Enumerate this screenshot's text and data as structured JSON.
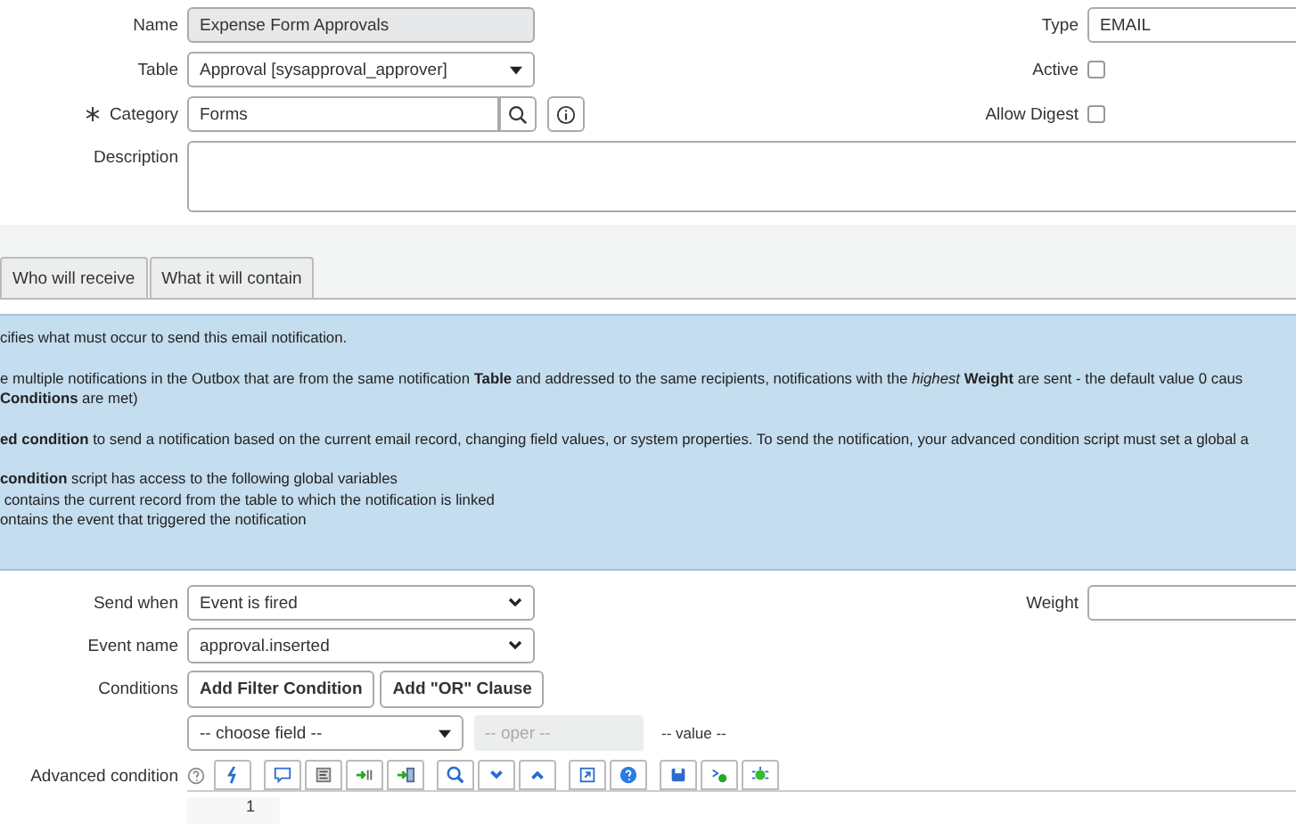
{
  "form": {
    "name": {
      "label": "Name",
      "value": "Expense Form Approvals",
      "readonly": true
    },
    "table": {
      "label": "Table",
      "value": "Approval [sysapproval_approver]"
    },
    "category": {
      "label": "Category",
      "value": "Forms",
      "required": true
    },
    "description": {
      "label": "Description"
    },
    "type": {
      "label": "Type",
      "value": "EMAIL"
    },
    "active": {
      "label": "Active",
      "checked": false
    },
    "allow_digest": {
      "label": "Allow Digest",
      "checked": false
    }
  },
  "tabs": [
    {
      "label": "Who will receive",
      "selected": false
    },
    {
      "label": "What it will contain",
      "selected": false
    }
  ],
  "info": [
    [
      "cifies what must occur to send this email notification."
    ],
    [
      "e multiple notifications in the Outbox that are from the same notification **Table** and addressed to the same recipients, notifications with the *highest* **Weight** are sent - the default value 0 caus",
      "**Conditions** are met)"
    ],
    [
      "**ed condition** to send a notification based on the current email record, changing field values, or system properties. To send the notification, your advanced condition script must set a global a"
    ],
    [
      "**condition** script has access to the following global variables",
      " contains the current record from the table to which the notification is linked",
      "ontains the event that triggered the notification"
    ]
  ],
  "send_when": {
    "label": "Send when",
    "value": "Event is fired"
  },
  "weight": {
    "label": "Weight"
  },
  "event_name": {
    "label": "Event name",
    "value": "approval.inserted"
  },
  "conditions": {
    "label": "Conditions",
    "buttons": [
      "Add Filter Condition",
      "Add \"OR\" Clause"
    ],
    "field": "-- choose field --",
    "operator": "-- oper --",
    "value": "-- value --"
  },
  "advanced_condition": {
    "label": "Advanced condition",
    "line_numbers": [
      "1"
    ]
  }
}
